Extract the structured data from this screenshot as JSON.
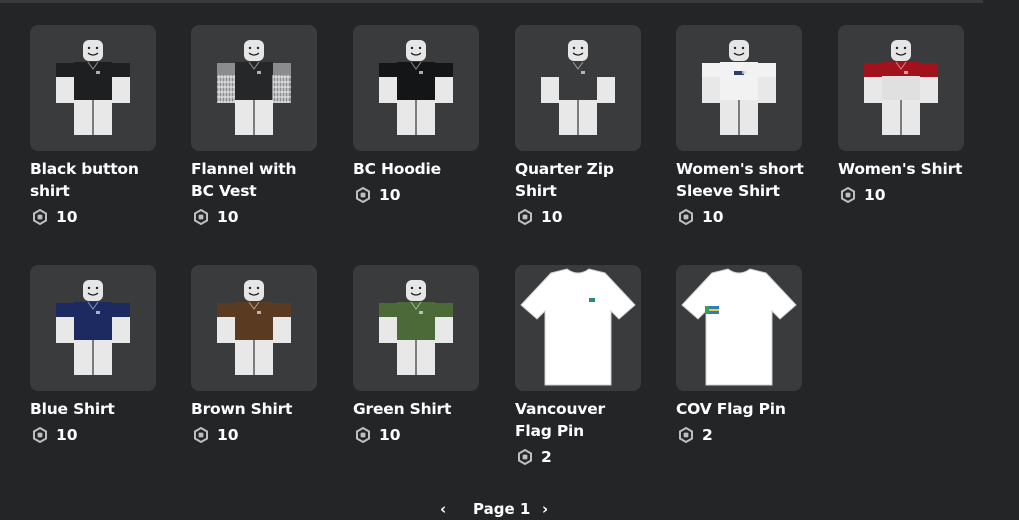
{
  "items": [
    {
      "name": "Black button shirt",
      "price": "10",
      "kind": "avatar",
      "shirt": "#1e1f20",
      "sleeve": "#1e1f20",
      "pattern": "plain"
    },
    {
      "name": "Flannel with BC Vest",
      "price": "10",
      "kind": "avatar",
      "shirt": "#262728",
      "sleeve": "#8a8c8e",
      "pattern": "plaid"
    },
    {
      "name": "BC Hoodie",
      "price": "10",
      "kind": "avatar",
      "shirt": "#141516",
      "sleeve": "#141516",
      "pattern": "plain"
    },
    {
      "name": "Quarter Zip Shirt",
      "price": "10",
      "kind": "avatar",
      "shirt": "#3a3b3c",
      "sleeve": "#3a3b3c",
      "pattern": "plain"
    },
    {
      "name": "Women's short Sleeve Shirt",
      "price": "10",
      "kind": "avatar",
      "shirt": "#f2f2f2",
      "sleeve": "#f2f2f2",
      "pattern": "logo"
    },
    {
      "name": "Women's Shirt",
      "price": "10",
      "kind": "avatar",
      "shirt": "#e0e0e0",
      "sleeve": "#a1121c",
      "pattern": "redtop"
    },
    {
      "name": "Blue Shirt",
      "price": "10",
      "kind": "avatar",
      "shirt": "#1d2a62",
      "sleeve": "#1d2a62",
      "pattern": "plain"
    },
    {
      "name": "Brown Shirt",
      "price": "10",
      "kind": "avatar",
      "shirt": "#5b3a22",
      "sleeve": "#5b3a22",
      "pattern": "plain"
    },
    {
      "name": "Green Shirt",
      "price": "10",
      "kind": "avatar",
      "shirt": "#4b6a37",
      "sleeve": "#4b6a37",
      "pattern": "plain"
    },
    {
      "name": "Vancouver Flag Pin",
      "price": "2",
      "kind": "tshirt",
      "shirt": "#ffffff",
      "sleeve": "#ffffff",
      "pattern": "pin-small"
    },
    {
      "name": "COV Flag Pin",
      "price": "2",
      "kind": "tshirt",
      "shirt": "#ffffff",
      "sleeve": "#ffffff",
      "pattern": "pin-large"
    }
  ],
  "pager": {
    "prev": "‹",
    "label": "Page 1",
    "next": "›"
  },
  "colors": {
    "background": "#232527",
    "card": "#393b3d",
    "text": "#ffffff",
    "robux": "#bdbebe"
  }
}
